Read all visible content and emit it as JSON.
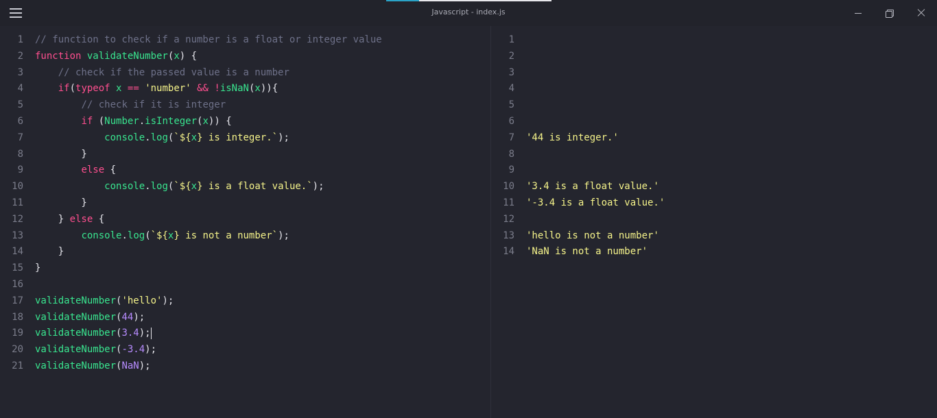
{
  "window": {
    "title": "Javascript - index.js",
    "progress": 0.2
  },
  "icons": [
    "menu-icon",
    "minimize-icon",
    "restore-icon",
    "close-icon"
  ],
  "colors": {
    "background": "#24252e",
    "comment": "#6e7189",
    "keyword": "#ff4f8f",
    "function": "#39e58f",
    "string": "#f5f38a",
    "number": "#b78cff",
    "accent": "#2aa3c7"
  },
  "editor": {
    "lines": [
      {
        "n": "1",
        "t": [
          [
            "cm",
            "// function to check if a number is a float or integer value"
          ]
        ]
      },
      {
        "n": "2",
        "t": [
          [
            "kw",
            "function "
          ],
          [
            "fn",
            "validateNumber"
          ],
          [
            "tx",
            "("
          ],
          [
            "vr",
            "x"
          ],
          [
            "tx",
            ") {"
          ]
        ]
      },
      {
        "n": "3",
        "t": [
          [
            "tx",
            "    "
          ],
          [
            "cm",
            "// check if the passed value is a number"
          ]
        ]
      },
      {
        "n": "4",
        "t": [
          [
            "tx",
            "    "
          ],
          [
            "kw",
            "if"
          ],
          [
            "tx",
            "("
          ],
          [
            "kw",
            "typeof"
          ],
          [
            "tx",
            " "
          ],
          [
            "vr",
            "x"
          ],
          [
            "tx",
            " "
          ],
          [
            "kw",
            "=="
          ],
          [
            "tx",
            " "
          ],
          [
            "st",
            "'number'"
          ],
          [
            "tx",
            " "
          ],
          [
            "kw",
            "&&"
          ],
          [
            "tx",
            " "
          ],
          [
            "kw",
            "!"
          ],
          [
            "fn",
            "isNaN"
          ],
          [
            "tx",
            "("
          ],
          [
            "vr",
            "x"
          ],
          [
            "tx",
            ")){"
          ]
        ]
      },
      {
        "n": "5",
        "t": [
          [
            "tx",
            "        "
          ],
          [
            "cm",
            "// check if it is integer"
          ]
        ]
      },
      {
        "n": "6",
        "t": [
          [
            "tx",
            "        "
          ],
          [
            "kw",
            "if"
          ],
          [
            "tx",
            " ("
          ],
          [
            "fn",
            "Number"
          ],
          [
            "tx",
            "."
          ],
          [
            "fn",
            "isInteger"
          ],
          [
            "tx",
            "("
          ],
          [
            "vr",
            "x"
          ],
          [
            "tx",
            ")) {"
          ]
        ]
      },
      {
        "n": "7",
        "t": [
          [
            "tx",
            "            "
          ],
          [
            "fn",
            "console"
          ],
          [
            "tx",
            "."
          ],
          [
            "fn",
            "log"
          ],
          [
            "tx",
            "("
          ],
          [
            "st",
            "`${"
          ],
          [
            "vr",
            "x"
          ],
          [
            "st",
            "} is integer.`"
          ],
          [
            "tx",
            ");"
          ]
        ]
      },
      {
        "n": "8",
        "t": [
          [
            "tx",
            "        }"
          ]
        ]
      },
      {
        "n": "9",
        "t": [
          [
            "tx",
            "        "
          ],
          [
            "kw",
            "else"
          ],
          [
            "tx",
            " {"
          ]
        ]
      },
      {
        "n": "10",
        "t": [
          [
            "tx",
            "            "
          ],
          [
            "fn",
            "console"
          ],
          [
            "tx",
            "."
          ],
          [
            "fn",
            "log"
          ],
          [
            "tx",
            "("
          ],
          [
            "st",
            "`${"
          ],
          [
            "vr",
            "x"
          ],
          [
            "st",
            "} is a float value.`"
          ],
          [
            "tx",
            ");"
          ]
        ]
      },
      {
        "n": "11",
        "t": [
          [
            "tx",
            "        }"
          ]
        ]
      },
      {
        "n": "12",
        "t": [
          [
            "tx",
            "    } "
          ],
          [
            "kw",
            "else"
          ],
          [
            "tx",
            " {"
          ]
        ]
      },
      {
        "n": "13",
        "t": [
          [
            "tx",
            "        "
          ],
          [
            "fn",
            "console"
          ],
          [
            "tx",
            "."
          ],
          [
            "fn",
            "log"
          ],
          [
            "tx",
            "("
          ],
          [
            "st",
            "`${"
          ],
          [
            "vr",
            "x"
          ],
          [
            "st",
            "} is not a number`"
          ],
          [
            "tx",
            ");"
          ]
        ]
      },
      {
        "n": "14",
        "t": [
          [
            "tx",
            "    }"
          ]
        ]
      },
      {
        "n": "15",
        "t": [
          [
            "tx",
            "}"
          ]
        ]
      },
      {
        "n": "16",
        "t": []
      },
      {
        "n": "17",
        "t": [
          [
            "fn",
            "validateNumber"
          ],
          [
            "tx",
            "("
          ],
          [
            "st",
            "'hello'"
          ],
          [
            "tx",
            ");"
          ]
        ]
      },
      {
        "n": "18",
        "t": [
          [
            "fn",
            "validateNumber"
          ],
          [
            "tx",
            "("
          ],
          [
            "nm",
            "44"
          ],
          [
            "tx",
            ");"
          ]
        ]
      },
      {
        "n": "19",
        "t": [
          [
            "fn",
            "validateNumber"
          ],
          [
            "tx",
            "("
          ],
          [
            "nm",
            "3.4"
          ],
          [
            "tx",
            ");"
          ]
        ],
        "caret": true
      },
      {
        "n": "20",
        "t": [
          [
            "fn",
            "validateNumber"
          ],
          [
            "tx",
            "("
          ],
          [
            "nm",
            "-3.4"
          ],
          [
            "tx",
            ");"
          ]
        ]
      },
      {
        "n": "21",
        "t": [
          [
            "fn",
            "validateNumber"
          ],
          [
            "tx",
            "("
          ],
          [
            "nm",
            "NaN"
          ],
          [
            "tx",
            ");"
          ]
        ]
      }
    ]
  },
  "output": {
    "lines": [
      {
        "n": "1",
        "text": ""
      },
      {
        "n": "2",
        "text": ""
      },
      {
        "n": "3",
        "text": ""
      },
      {
        "n": "4",
        "text": ""
      },
      {
        "n": "5",
        "text": ""
      },
      {
        "n": "6",
        "text": ""
      },
      {
        "n": "7",
        "text": "'44 is integer.'"
      },
      {
        "n": "8",
        "text": ""
      },
      {
        "n": "9",
        "text": ""
      },
      {
        "n": "10",
        "text": "'3.4 is a float value.'"
      },
      {
        "n": "11",
        "text": "'-3.4 is a float value.'"
      },
      {
        "n": "12",
        "text": ""
      },
      {
        "n": "13",
        "text": "'hello is not a number'"
      },
      {
        "n": "14",
        "text": "'NaN is not a number'"
      }
    ]
  }
}
